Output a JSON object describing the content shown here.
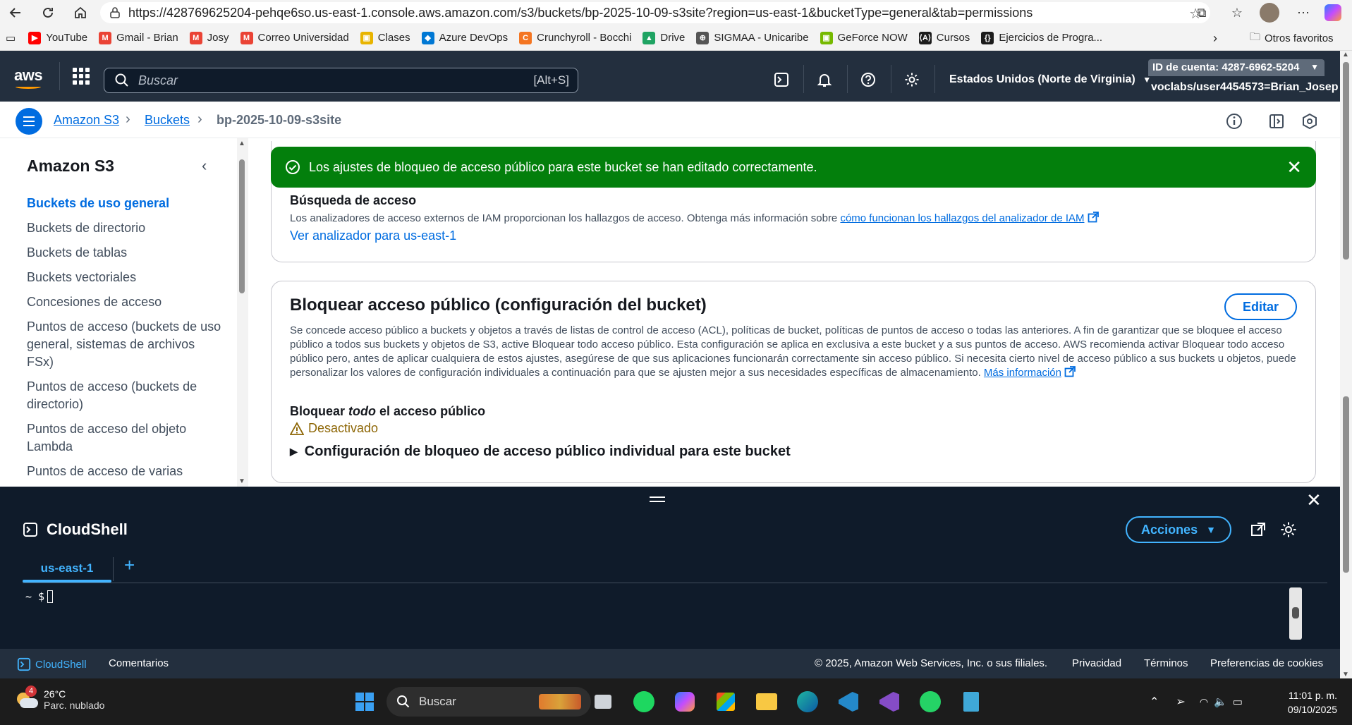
{
  "browser": {
    "url": "https://428769625204-pehqe6so.us-east-1.console.aws.amazon.com/s3/buckets/bp-2025-10-09-s3site?region=us-east-1&bucketType=general&tab=permissions",
    "bookmarks": [
      {
        "label": "YouTube",
        "color": "#ff0000",
        "glyph": "▶"
      },
      {
        "label": "Gmail - Brian",
        "color": "#ea4335",
        "glyph": "M"
      },
      {
        "label": "Josy",
        "color": "#ea4335",
        "glyph": "M"
      },
      {
        "label": "Correo Universidad",
        "color": "#ea4335",
        "glyph": "M"
      },
      {
        "label": "Clases",
        "color": "#e8b400",
        "glyph": "▣"
      },
      {
        "label": "Azure DevOps",
        "color": "#0078d4",
        "glyph": "◆"
      },
      {
        "label": "Crunchyroll - Bocchi",
        "color": "#f47521",
        "glyph": "C"
      },
      {
        "label": "Drive",
        "color": "#1fa463",
        "glyph": "▲"
      },
      {
        "label": "SIGMAA - Unicaribe",
        "color": "#555555",
        "glyph": "⊕"
      },
      {
        "label": "GeForce NOW",
        "color": "#76b900",
        "glyph": "▣"
      },
      {
        "label": "Cursos",
        "color": "#1c1c1c",
        "glyph": "⟨A⟩"
      },
      {
        "label": "Ejercicios de Progra...",
        "color": "#1c1c1c",
        "glyph": "{}"
      }
    ],
    "bookmarks_more": "Otros favoritos"
  },
  "header": {
    "logo": "aws",
    "search_placeholder": "Buscar",
    "search_shortcut": "[Alt+S]",
    "region": "Estados Unidos (Norte de Virginia)",
    "account_id": "ID de cuenta: 4287-6962-5204",
    "user": "voclabs/user4454573=Brian_Josep"
  },
  "breadcrumb": {
    "items": [
      "Amazon S3",
      "Buckets"
    ],
    "current": "bp-2025-10-09-s3site"
  },
  "sidebar": {
    "title": "Amazon S3",
    "items": [
      {
        "label": "Buckets de uso general",
        "active": true
      },
      {
        "label": "Buckets de directorio"
      },
      {
        "label": "Buckets de tablas"
      },
      {
        "label": "Buckets vectoriales"
      },
      {
        "label": "Concesiones de acceso"
      },
      {
        "label": "Puntos de acceso (buckets de uso general, sistemas de archivos FSx)"
      },
      {
        "label": "Puntos de acceso (buckets de directorio)"
      },
      {
        "label": "Puntos de acceso del objeto Lambda"
      },
      {
        "label": "Puntos de acceso de varias"
      }
    ]
  },
  "flash": {
    "message": "Los ajustes de bloqueo de acceso público para este bucket se han editado correctamente."
  },
  "access_finding": {
    "title": "Búsqueda de acceso",
    "description": "Los analizadores de acceso externos de IAM proporcionan los hallazgos de acceso. Obtenga más información sobre",
    "link": "cómo funcionan los hallazgos del analizador de IAM",
    "analyzer_link": "Ver analizador para us-east-1"
  },
  "block_public": {
    "title": "Bloquear acceso público (configuración del bucket)",
    "edit_label": "Editar",
    "description": "Se concede acceso público a buckets y objetos a través de listas de control de acceso (ACL), políticas de bucket, políticas de puntos de acceso o todas las anteriores. A fin de garantizar que se bloquee el acceso público a todos sus buckets y objetos de S3, active Bloquear todo acceso público. Esta configuración se aplica en exclusiva a este bucket y a sus puntos de acceso. AWS recomienda activar Bloquear todo acceso público pero, antes de aplicar cualquiera de estos ajustes, asegúrese de que sus aplicaciones funcionarán correctamente sin acceso público. Si necesita cierto nivel de acceso público a sus buckets u objetos, puede personalizar los valores de configuración individuales a continuación para que se ajusten mejor a sus necesidades específicas de almacenamiento.",
    "more_info": "Más información",
    "block_all_prefix": "Bloquear",
    "block_all_em": "todo",
    "block_all_suffix": "el acceso público",
    "status": "Desactivado",
    "expand_label": "Configuración de bloqueo de acceso público individual para este bucket"
  },
  "cloudshell": {
    "title": "CloudShell",
    "actions_label": "Acciones",
    "tab": "us-east-1",
    "prompt": "~ $"
  },
  "footer": {
    "cloudshell": "CloudShell",
    "feedback": "Comentarios",
    "copyright": "© 2025, Amazon Web Services, Inc. o sus filiales.",
    "privacy": "Privacidad",
    "terms": "Términos",
    "cookies": "Preferencias de cookies"
  },
  "taskbar": {
    "weather_temp": "26°C",
    "weather_desc": "Parc. nublado",
    "weather_badge": "4",
    "search_placeholder": "Buscar",
    "time": "11:01 p. m.",
    "date": "09/10/2025"
  },
  "colors": {
    "aws_navy": "#232f3e",
    "link": "#006ce0",
    "success": "#037f0c",
    "warning": "#8d6605",
    "cloudshell_bg": "#0f1b2a"
  }
}
